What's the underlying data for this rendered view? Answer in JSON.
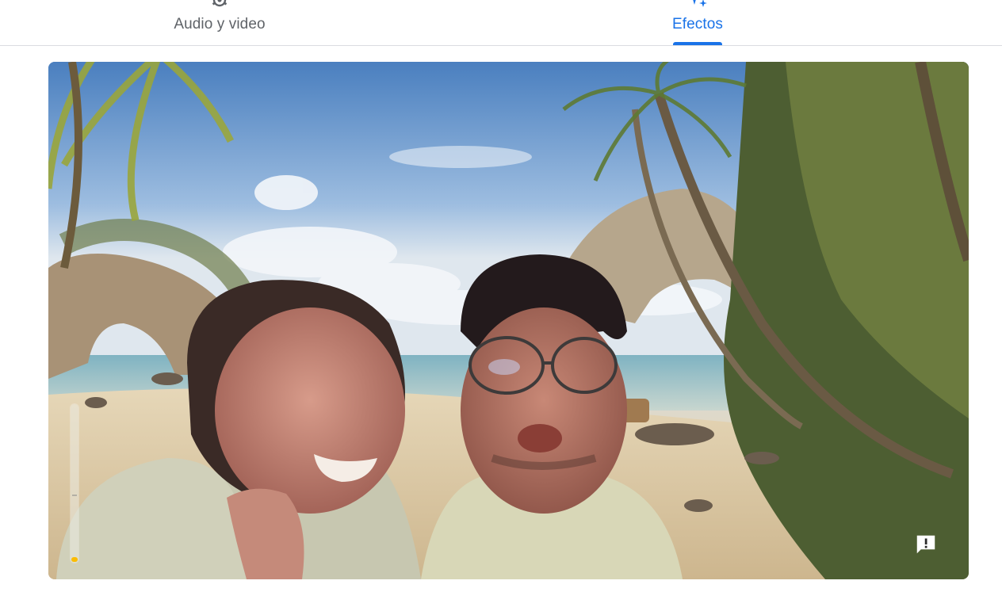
{
  "tabs": [
    {
      "label": "Audio y video",
      "icon": "settings-sound-icon",
      "selected": false
    },
    {
      "label": "Efectos",
      "icon": "sparkle-icon",
      "selected": true
    }
  ],
  "preview": {
    "background_effect": "beach-scene",
    "mic_level": 0.03,
    "feedback_icon": "feedback-icon"
  },
  "colors": {
    "accent": "#1a73e8",
    "tab_inactive": "#5f6368",
    "mic_level": "#fbbc04",
    "divider": "#dadce0"
  }
}
